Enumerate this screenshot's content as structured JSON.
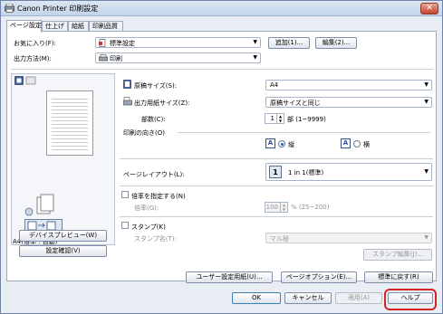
{
  "window": {
    "title": "Canon Printer 印刷設定",
    "close_glyph": "✕"
  },
  "tabs": [
    {
      "label": "ページ設定",
      "active": true
    },
    {
      "label": "仕上げ",
      "active": false
    },
    {
      "label": "給紙",
      "active": false
    },
    {
      "label": "印刷品質",
      "active": false
    }
  ],
  "favorites": {
    "label": "お気に入り(F):",
    "value": "標準設定",
    "add_button": "追加(1)...",
    "edit_button": "編集(2)..."
  },
  "output": {
    "label": "出力方法(M):",
    "value": "印刷"
  },
  "preview": {
    "caption": "A4(倍率 : 自動)"
  },
  "left_buttons": {
    "device_preview": "デバイスプレビュー(W)",
    "settings_confirm": "設定確認(V)"
  },
  "original_size": {
    "label": "原稿サイズ(S):",
    "value": "A4"
  },
  "output_size": {
    "label": "出力用紙サイズ(Z):",
    "value": "原稿サイズと同じ"
  },
  "copies": {
    "label": "部数(C):",
    "value": "1",
    "unit": "部 (1~9999)"
  },
  "orientation": {
    "label": "印刷の向き(O)",
    "portrait": "縦",
    "landscape": "横",
    "selected": "portrait"
  },
  "page_layout": {
    "label": "ページレイアウト(L):",
    "value": "1 in 1(標準)",
    "icon_number": "1"
  },
  "scaling": {
    "checkbox_label": "倍率を指定する(N)",
    "scale_label": "倍率(G):",
    "scale_value": "100",
    "scale_unit": "% (25~200)"
  },
  "stamp": {
    "checkbox_label": "スタンプ(K)",
    "name_label": "スタンプ名(T):",
    "name_value": "マル秘",
    "edit_button": "スタンプ編集(J)..."
  },
  "bottom_panel_buttons": {
    "user_paper": "ユーザー設定用紙(U)...",
    "page_options": "ページオプション(E)...",
    "restore_defaults": "標準に戻す(R)"
  },
  "dialog_buttons": {
    "ok": "OK",
    "cancel": "キャンセル",
    "apply": "適用(A)",
    "help": "ヘルプ"
  },
  "colors": {
    "highlight_ring": "#d42424",
    "title_gradient_top": "#dce6f4",
    "accent_blue": "#1f5fb8"
  }
}
